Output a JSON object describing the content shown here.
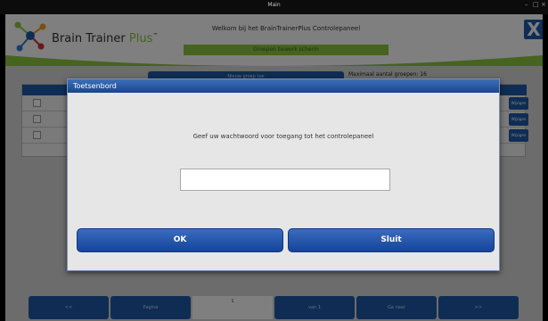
{
  "window": {
    "title": "Main",
    "controls": [
      "–",
      "□",
      "×"
    ]
  },
  "app": {
    "brand_name": "Brain Trainer",
    "brand_plus": "Plus",
    "brand_tm": "™",
    "welcome_text": "Welkom bij het BrainTrainerPlus Controlepaneel",
    "subtitle_text": "Groepen bewerk scherm",
    "close_glyph": "X",
    "new_group_label": "Nieuw groep toe",
    "max_groups_text": "Maximaal aantal groepen: 16",
    "edit_label": "Wijzigen",
    "footer": {
      "prev": "<<",
      "page_label": "Pagina",
      "page_number": "1",
      "of_label": "van 1",
      "goto_label": "Ga naar",
      "next": ">>"
    }
  },
  "dialog": {
    "title": "Toetsenbord",
    "prompt": "Geef uw wachtwoord voor toegang tot het controlepaneel",
    "password_value": "",
    "ok_label": "OK",
    "close_label": "Sluit"
  },
  "colors": {
    "accent_blue": "#1f5aa8",
    "brand_green": "#8cc63f"
  }
}
